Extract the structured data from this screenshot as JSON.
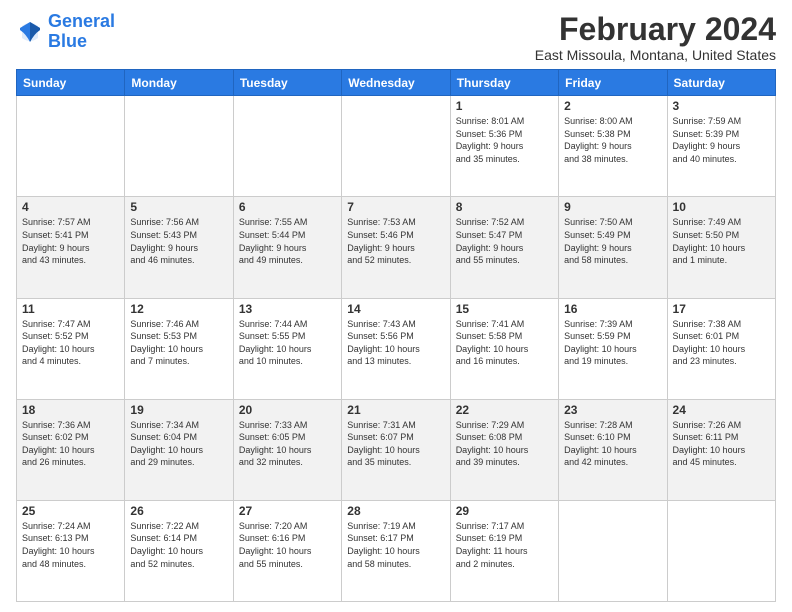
{
  "logo": {
    "line1": "General",
    "line2": "Blue"
  },
  "title": "February 2024",
  "subtitle": "East Missoula, Montana, United States",
  "days_of_week": [
    "Sunday",
    "Monday",
    "Tuesday",
    "Wednesday",
    "Thursday",
    "Friday",
    "Saturday"
  ],
  "weeks": [
    [
      {
        "day": "",
        "details": ""
      },
      {
        "day": "",
        "details": ""
      },
      {
        "day": "",
        "details": ""
      },
      {
        "day": "",
        "details": ""
      },
      {
        "day": "1",
        "details": "Sunrise: 8:01 AM\nSunset: 5:36 PM\nDaylight: 9 hours\nand 35 minutes."
      },
      {
        "day": "2",
        "details": "Sunrise: 8:00 AM\nSunset: 5:38 PM\nDaylight: 9 hours\nand 38 minutes."
      },
      {
        "day": "3",
        "details": "Sunrise: 7:59 AM\nSunset: 5:39 PM\nDaylight: 9 hours\nand 40 minutes."
      }
    ],
    [
      {
        "day": "4",
        "details": "Sunrise: 7:57 AM\nSunset: 5:41 PM\nDaylight: 9 hours\nand 43 minutes."
      },
      {
        "day": "5",
        "details": "Sunrise: 7:56 AM\nSunset: 5:43 PM\nDaylight: 9 hours\nand 46 minutes."
      },
      {
        "day": "6",
        "details": "Sunrise: 7:55 AM\nSunset: 5:44 PM\nDaylight: 9 hours\nand 49 minutes."
      },
      {
        "day": "7",
        "details": "Sunrise: 7:53 AM\nSunset: 5:46 PM\nDaylight: 9 hours\nand 52 minutes."
      },
      {
        "day": "8",
        "details": "Sunrise: 7:52 AM\nSunset: 5:47 PM\nDaylight: 9 hours\nand 55 minutes."
      },
      {
        "day": "9",
        "details": "Sunrise: 7:50 AM\nSunset: 5:49 PM\nDaylight: 9 hours\nand 58 minutes."
      },
      {
        "day": "10",
        "details": "Sunrise: 7:49 AM\nSunset: 5:50 PM\nDaylight: 10 hours\nand 1 minute."
      }
    ],
    [
      {
        "day": "11",
        "details": "Sunrise: 7:47 AM\nSunset: 5:52 PM\nDaylight: 10 hours\nand 4 minutes."
      },
      {
        "day": "12",
        "details": "Sunrise: 7:46 AM\nSunset: 5:53 PM\nDaylight: 10 hours\nand 7 minutes."
      },
      {
        "day": "13",
        "details": "Sunrise: 7:44 AM\nSunset: 5:55 PM\nDaylight: 10 hours\nand 10 minutes."
      },
      {
        "day": "14",
        "details": "Sunrise: 7:43 AM\nSunset: 5:56 PM\nDaylight: 10 hours\nand 13 minutes."
      },
      {
        "day": "15",
        "details": "Sunrise: 7:41 AM\nSunset: 5:58 PM\nDaylight: 10 hours\nand 16 minutes."
      },
      {
        "day": "16",
        "details": "Sunrise: 7:39 AM\nSunset: 5:59 PM\nDaylight: 10 hours\nand 19 minutes."
      },
      {
        "day": "17",
        "details": "Sunrise: 7:38 AM\nSunset: 6:01 PM\nDaylight: 10 hours\nand 23 minutes."
      }
    ],
    [
      {
        "day": "18",
        "details": "Sunrise: 7:36 AM\nSunset: 6:02 PM\nDaylight: 10 hours\nand 26 minutes."
      },
      {
        "day": "19",
        "details": "Sunrise: 7:34 AM\nSunset: 6:04 PM\nDaylight: 10 hours\nand 29 minutes."
      },
      {
        "day": "20",
        "details": "Sunrise: 7:33 AM\nSunset: 6:05 PM\nDaylight: 10 hours\nand 32 minutes."
      },
      {
        "day": "21",
        "details": "Sunrise: 7:31 AM\nSunset: 6:07 PM\nDaylight: 10 hours\nand 35 minutes."
      },
      {
        "day": "22",
        "details": "Sunrise: 7:29 AM\nSunset: 6:08 PM\nDaylight: 10 hours\nand 39 minutes."
      },
      {
        "day": "23",
        "details": "Sunrise: 7:28 AM\nSunset: 6:10 PM\nDaylight: 10 hours\nand 42 minutes."
      },
      {
        "day": "24",
        "details": "Sunrise: 7:26 AM\nSunset: 6:11 PM\nDaylight: 10 hours\nand 45 minutes."
      }
    ],
    [
      {
        "day": "25",
        "details": "Sunrise: 7:24 AM\nSunset: 6:13 PM\nDaylight: 10 hours\nand 48 minutes."
      },
      {
        "day": "26",
        "details": "Sunrise: 7:22 AM\nSunset: 6:14 PM\nDaylight: 10 hours\nand 52 minutes."
      },
      {
        "day": "27",
        "details": "Sunrise: 7:20 AM\nSunset: 6:16 PM\nDaylight: 10 hours\nand 55 minutes."
      },
      {
        "day": "28",
        "details": "Sunrise: 7:19 AM\nSunset: 6:17 PM\nDaylight: 10 hours\nand 58 minutes."
      },
      {
        "day": "29",
        "details": "Sunrise: 7:17 AM\nSunset: 6:19 PM\nDaylight: 11 hours\nand 2 minutes."
      },
      {
        "day": "",
        "details": ""
      },
      {
        "day": "",
        "details": ""
      }
    ]
  ]
}
